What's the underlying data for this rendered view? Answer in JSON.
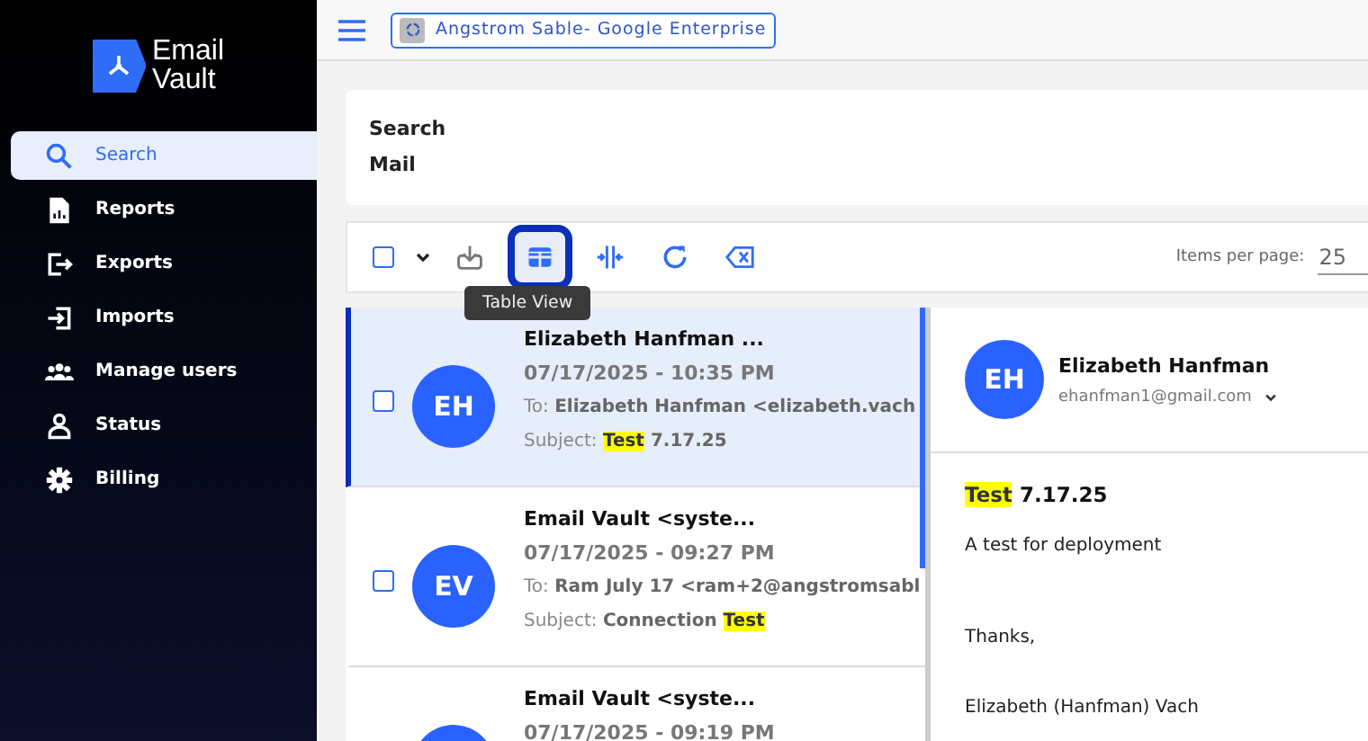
{
  "logo": {
    "lines": [
      "Email",
      "Vault"
    ]
  },
  "sidebar": {
    "items": [
      {
        "label": "Search",
        "selected": true
      },
      {
        "label": "Reports",
        "selected": false
      },
      {
        "label": "Exports",
        "selected": false
      },
      {
        "label": "Imports",
        "selected": false
      },
      {
        "label": "Manage users",
        "selected": false
      },
      {
        "label": "Status",
        "selected": false
      },
      {
        "label": "Billing",
        "selected": false
      }
    ]
  },
  "topbar": {
    "account": "Angstrom Sable- Google Enterprise"
  },
  "search_card": {
    "title_lines": [
      "Search",
      "Mail"
    ]
  },
  "toolbar": {
    "select_all": {
      "checked": false
    },
    "tools": [
      {
        "selected": false
      },
      {
        "selected": true
      },
      {
        "selected": false
      },
      {
        "selected": false
      },
      {
        "selected": false
      }
    ],
    "tooltip": "Table View",
    "items_per_page_label": "Items per page:",
    "items_per_page": "25"
  },
  "messages": [
    {
      "selected": true,
      "checked": false,
      "initials": "EH",
      "sender": "Elizabeth Hanfman ...",
      "date": "07/17/2025 - 10:35 PM",
      "to_label": "To:",
      "to": "Elizabeth Hanfman <elizabeth.vach",
      "subject_label": "Subject:",
      "subject": [
        {
          "text": "Test",
          "highlighted": true
        },
        {
          "text": " 7.17.25",
          "highlighted": false
        }
      ]
    },
    {
      "selected": false,
      "checked": false,
      "initials": "EV",
      "sender": "Email Vault <syste...",
      "date": "07/17/2025 - 09:27 PM",
      "to_label": "To:",
      "to": "Ram July 17 <ram+2@angstromsabl",
      "subject_label": "Subject:",
      "subject": [
        {
          "text": "Connection ",
          "highlighted": false
        },
        {
          "text": "Test",
          "highlighted": true
        }
      ]
    },
    {
      "selected": false,
      "sender": "Email Vault <syste...",
      "date": "07/17/2025 - 09:19 PM"
    }
  ],
  "detail": {
    "initials": "EH",
    "sender": "Elizabeth Hanfman",
    "email": "ehanfman1@gmail.com",
    "subject": [
      {
        "text": "Test",
        "highlighted": true
      },
      {
        "text": " 7.17.25",
        "highlighted": false
      }
    ],
    "body": [
      "A test for deployment",
      "Thanks,",
      "Elizabeth (Hanfman) Vach"
    ]
  }
}
